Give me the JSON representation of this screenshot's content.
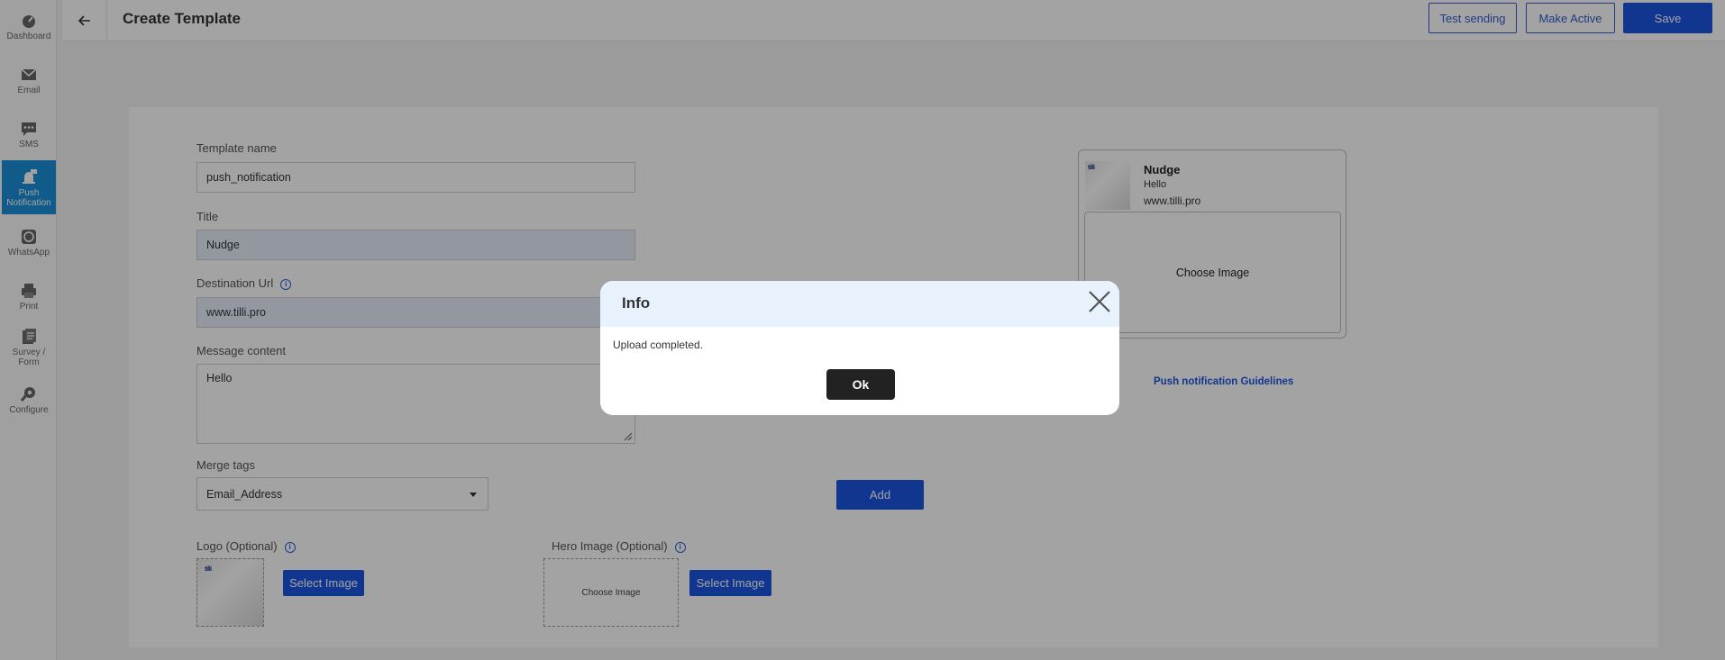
{
  "sidebar": {
    "items": [
      {
        "label": "Dashboard",
        "icon": "dashboard-icon"
      },
      {
        "label": "Email",
        "icon": "email-icon"
      },
      {
        "label": "SMS",
        "icon": "sms-icon"
      },
      {
        "label": "Push Notification",
        "icon": "push-notification-icon",
        "active": true
      },
      {
        "label": "WhatsApp",
        "icon": "whatsapp-icon"
      },
      {
        "label": "Print",
        "icon": "print-icon"
      },
      {
        "label": "Survey / Form",
        "icon": "survey-icon"
      },
      {
        "label": "Configure",
        "icon": "configure-icon"
      }
    ]
  },
  "header": {
    "title": "Create Template",
    "test_sending": "Test sending",
    "make_active": "Make Active",
    "save": "Save"
  },
  "form": {
    "template_name_label": "Template name",
    "template_name_value": "push_notification",
    "title_label": "Title",
    "title_value": "Nudge",
    "destination_label": "Destination Url",
    "destination_value": "www.tilli.pro",
    "message_label": "Message content",
    "message_value": "Hello",
    "merge_tags_label": "Merge tags",
    "merge_tags_value": "Email_Address",
    "add_button": "Add",
    "logo_label": "Logo (Optional)",
    "logo_select": "Select Image",
    "logo_thumb_text": "tilli",
    "hero_label": "Hero Image (Optional)",
    "hero_choose": "Choose Image",
    "hero_select": "Select Image"
  },
  "preview": {
    "title": "Nudge",
    "message": "Hello",
    "url": "www.tilli.pro",
    "choose_image": "Choose Image",
    "thumb_text": "tilli",
    "guidelines_link": "Push notification Guidelines"
  },
  "modal": {
    "title": "Info",
    "body": "Upload completed.",
    "ok": "Ok"
  },
  "colors": {
    "accent": "#1c55e0",
    "sidebar_active": "#1a8fd6",
    "modal_header": "#e8f2fd"
  }
}
